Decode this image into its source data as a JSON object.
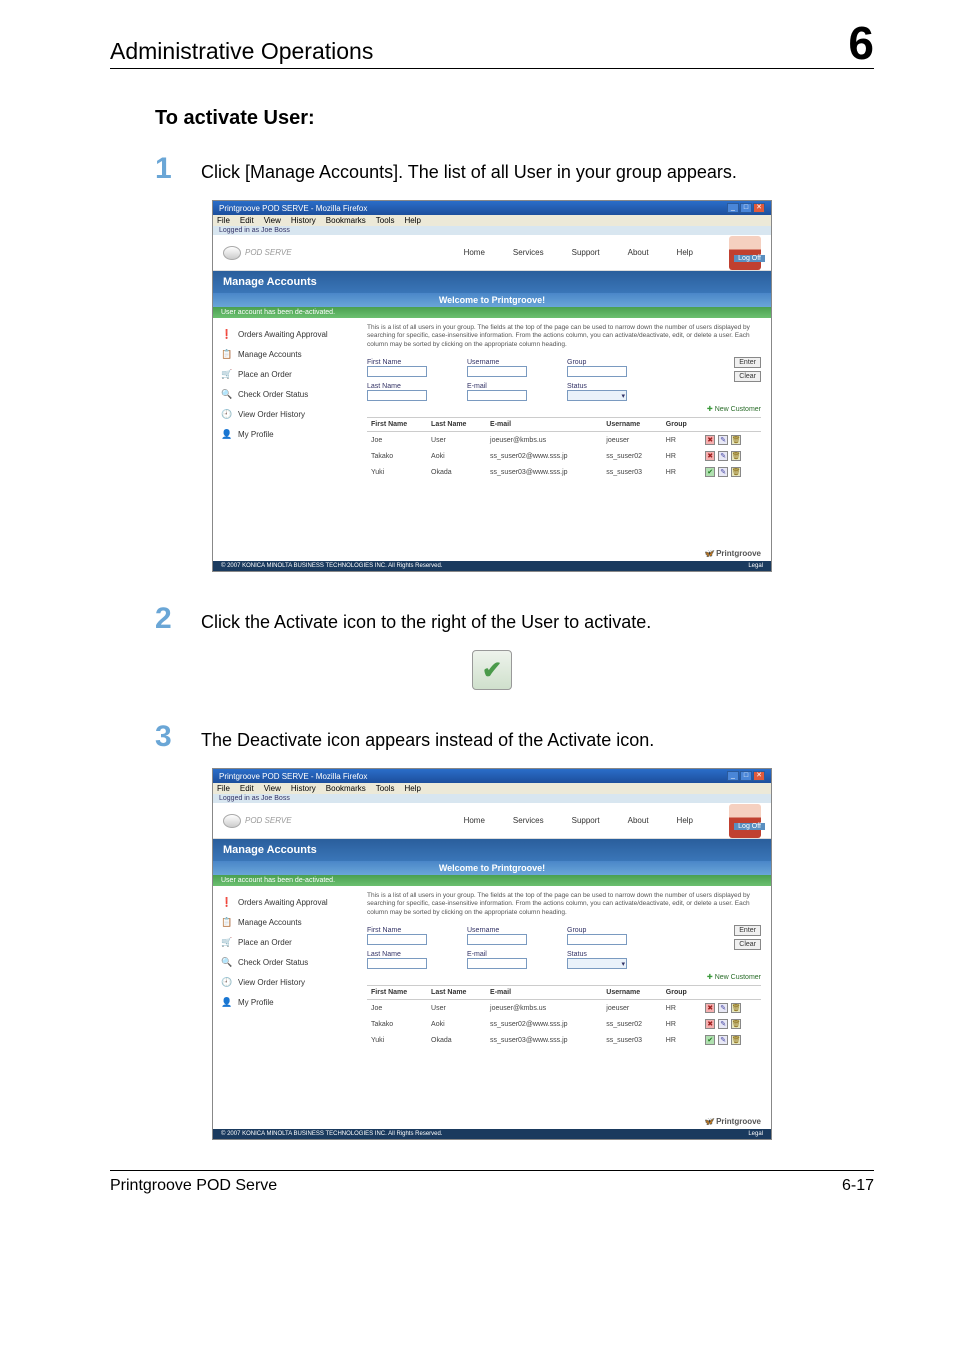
{
  "header": {
    "title": "Administrative Operations",
    "chapter": "6"
  },
  "section": {
    "heading": "To activate User:"
  },
  "steps": [
    {
      "num": "1",
      "text": "Click [Manage Accounts]. The list of all User in your group appears."
    },
    {
      "num": "2",
      "text": "Click the Activate icon to the right of the User to activate."
    },
    {
      "num": "3",
      "text": "The Deactivate icon appears instead of the Activate icon."
    }
  ],
  "activate_icon_glyph": "✔",
  "screenshot": {
    "window_title": "Printgroove POD SERVE - Mozilla Firefox",
    "menubar": [
      "File",
      "Edit",
      "View",
      "History",
      "Bookmarks",
      "Tools",
      "Help"
    ],
    "login_bar": "Logged in as Joe Boss",
    "logo_text": "POD SERVE",
    "topnav": [
      "Home",
      "Services",
      "Support",
      "About",
      "Help"
    ],
    "logoff": "Log Off",
    "band_title": "Manage Accounts",
    "welcome": "Welcome to Printgroove!",
    "sidebar": [
      {
        "icon": "❗",
        "label": "Orders Awaiting Approval"
      },
      {
        "icon": "📋",
        "label": "Manage Accounts"
      },
      {
        "icon": "🛒",
        "label": "Place an Order"
      },
      {
        "icon": "🔍",
        "label": "Check Order Status"
      },
      {
        "icon": "🕘",
        "label": "View Order History"
      },
      {
        "icon": "👤",
        "label": "My Profile"
      }
    ],
    "intro_text": "This is a list of all users in your group. The fields at the top of the page can be used to narrow down the number of users displayed by searching for specific, case-insensitive information. From the actions column, you can activate/deactivate, edit, or delete a user. Each column may be sorted by clicking on the appropriate column heading.",
    "filters": {
      "first_name": "First Name",
      "last_name": "Last Name",
      "username": "Username",
      "email": "E-mail",
      "group": "Group",
      "status": "Status",
      "enter": "Enter",
      "clear": "Clear"
    },
    "new_customer": "New Customer",
    "table": {
      "headers": [
        "First Name",
        "Last Name",
        "E-mail",
        "Username",
        "Group"
      ],
      "rows": [
        {
          "first": "Joe",
          "last": "User",
          "email": "joeuser@kmbs.us",
          "username": "joeuser",
          "group": "HR",
          "state": "de"
        },
        {
          "first": "Takako",
          "last": "Aoki",
          "email": "ss_suser02@www.sss.jp",
          "username": "ss_suser02",
          "group": "HR",
          "state": "de"
        },
        {
          "first": "Yuki",
          "last": "Okada",
          "email": "ss_suser03@www.sss.jp",
          "username": "ss_suser03",
          "group": "HR",
          "state": "ac"
        }
      ]
    },
    "footer_copyright": "© 2007 KONICA MINOLTA BUSINESS TECHNOLOGIES INC. All Rights Reserved.",
    "footer_legal": "Legal",
    "brand": "Printgroove"
  },
  "green_msg": {
    "deactivated": "User account has been de-activated.",
    "activated": "User account has been de-activated."
  },
  "screenshot2_rows": [
    {
      "first": "Joe",
      "last": "User",
      "email": "joeuser@kmbs.us",
      "username": "joeuser",
      "group": "HR",
      "state": "de"
    },
    {
      "first": "Takako",
      "last": "Aoki",
      "email": "ss_suser02@www.sss.jp",
      "username": "ss_suser02",
      "group": "HR",
      "state": "de"
    },
    {
      "first": "Yuki",
      "last": "Okada",
      "email": "ss_suser03@www.sss.jp",
      "username": "ss_suser03",
      "group": "HR",
      "state": "ac"
    }
  ],
  "page_footer": {
    "left": "Printgroove POD Serve",
    "right": "6-17"
  }
}
